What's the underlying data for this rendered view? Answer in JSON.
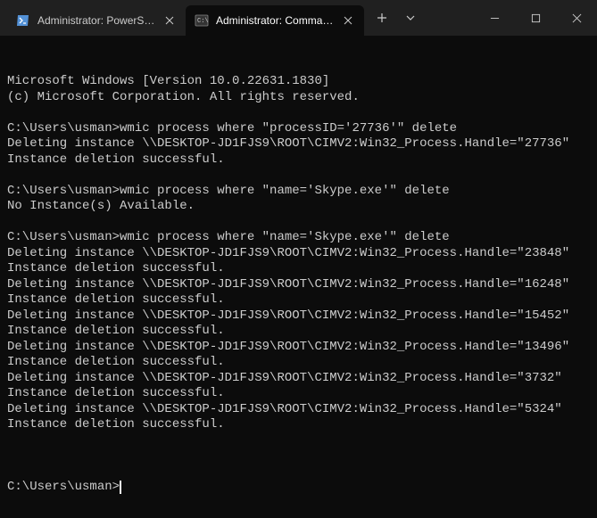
{
  "titlebar": {
    "tabs": [
      {
        "label": "Administrator: PowerShell",
        "icon": "powershell-icon"
      },
      {
        "label": "Administrator: Command Pro",
        "icon": "cmd-icon"
      }
    ]
  },
  "terminal": {
    "prompt": "C:\\Users\\usman>",
    "lines": [
      "Microsoft Windows [Version 10.0.22631.1830]",
      "(c) Microsoft Corporation. All rights reserved.",
      "",
      "C:\\Users\\usman>wmic process where \"processID='27736'\" delete",
      "Deleting instance \\\\DESKTOP-JD1FJS9\\ROOT\\CIMV2:Win32_Process.Handle=\"27736\"",
      "Instance deletion successful.",
      "",
      "C:\\Users\\usman>wmic process where \"name='Skype.exe'\" delete",
      "No Instance(s) Available.",
      "",
      "C:\\Users\\usman>wmic process where \"name='Skype.exe'\" delete",
      "Deleting instance \\\\DESKTOP-JD1FJS9\\ROOT\\CIMV2:Win32_Process.Handle=\"23848\"",
      "Instance deletion successful.",
      "Deleting instance \\\\DESKTOP-JD1FJS9\\ROOT\\CIMV2:Win32_Process.Handle=\"16248\"",
      "Instance deletion successful.",
      "Deleting instance \\\\DESKTOP-JD1FJS9\\ROOT\\CIMV2:Win32_Process.Handle=\"15452\"",
      "Instance deletion successful.",
      "Deleting instance \\\\DESKTOP-JD1FJS9\\ROOT\\CIMV2:Win32_Process.Handle=\"13496\"",
      "Instance deletion successful.",
      "Deleting instance \\\\DESKTOP-JD1FJS9\\ROOT\\CIMV2:Win32_Process.Handle=\"3732\"",
      "Instance deletion successful.",
      "Deleting instance \\\\DESKTOP-JD1FJS9\\ROOT\\CIMV2:Win32_Process.Handle=\"5324\"",
      "Instance deletion successful.",
      ""
    ]
  }
}
